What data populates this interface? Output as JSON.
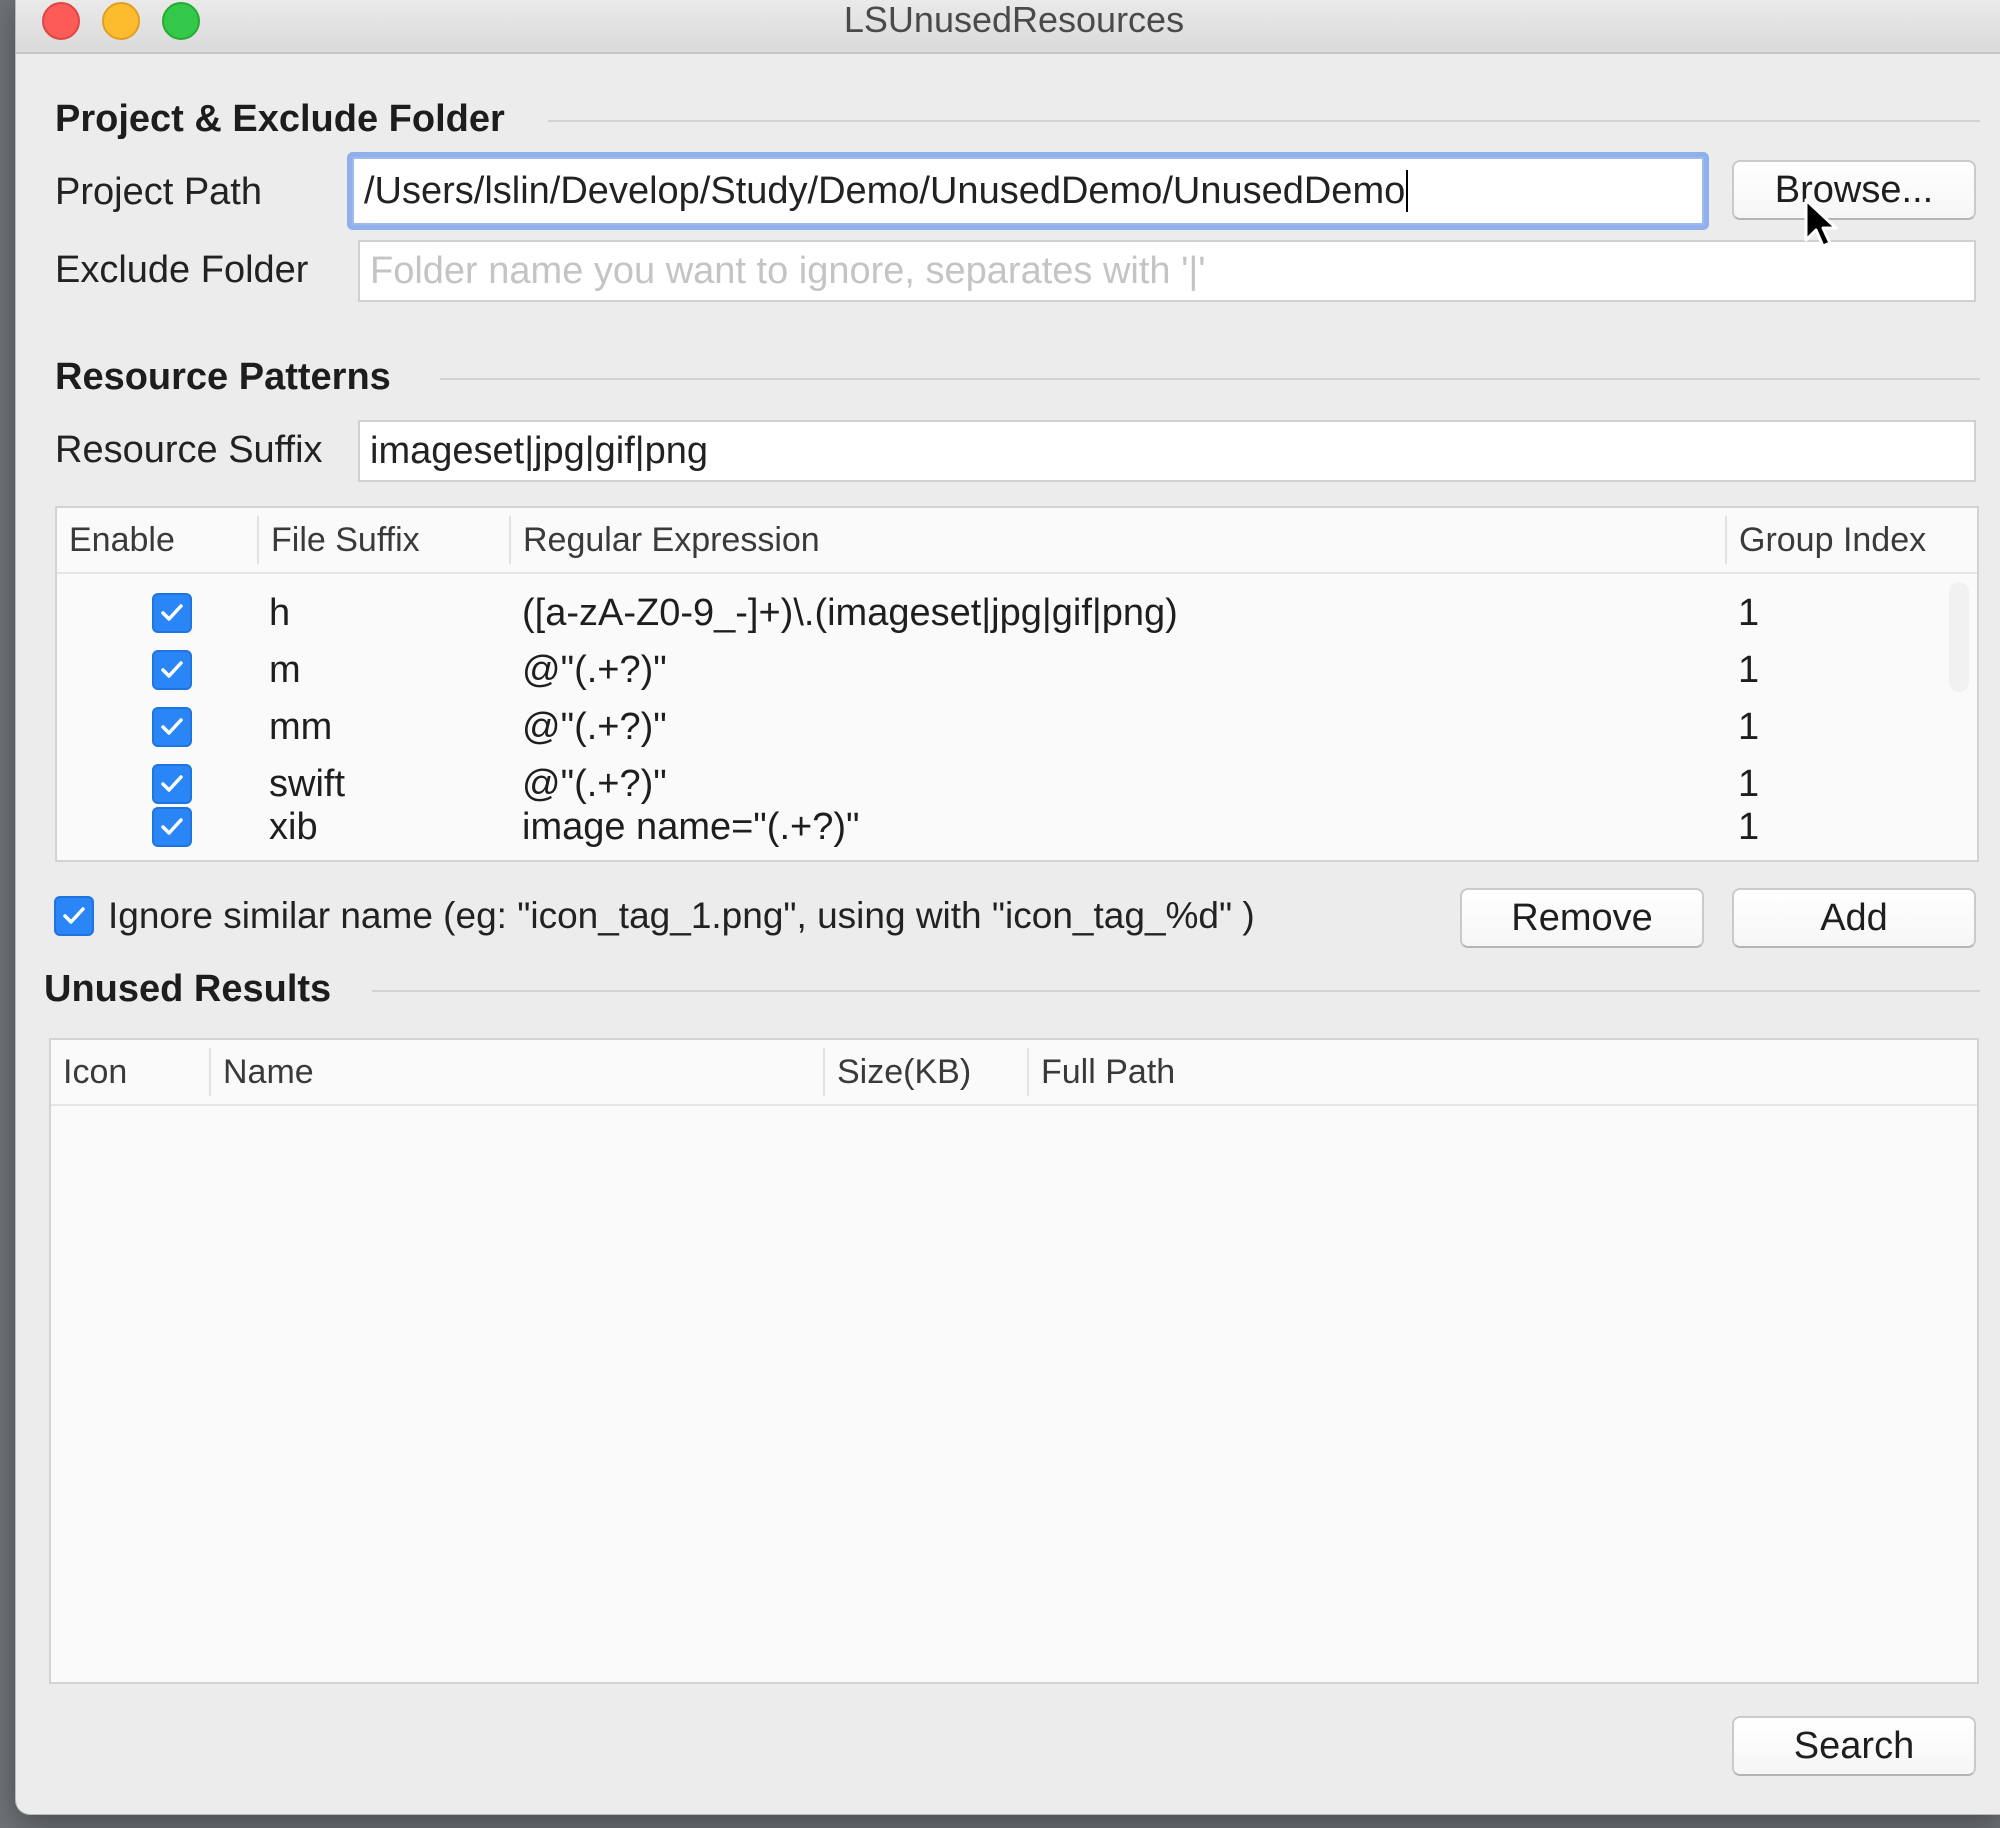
{
  "window": {
    "title": "LSUnusedResources"
  },
  "project_section": {
    "header": "Project & Exclude Folder",
    "project_path_label": "Project Path",
    "project_path_value": "/Users/lslin/Develop/Study/Demo/UnusedDemo/UnusedDemo",
    "browse_button": "Browse...",
    "exclude_folder_label": "Exclude Folder",
    "exclude_folder_placeholder": "Folder name you want to ignore, separates with '|'"
  },
  "patterns_section": {
    "header": "Resource Patterns",
    "resource_suffix_label": "Resource Suffix",
    "resource_suffix_value": "imageset|jpg|gif|png",
    "columns": [
      "Enable",
      "File Suffix",
      "Regular Expression",
      "Group Index"
    ],
    "rows": [
      {
        "enabled": true,
        "suffix": "h",
        "regex": "([a-zA-Z0-9_-]+)\\.(imageset|jpg|gif|png)",
        "group": "1"
      },
      {
        "enabled": true,
        "suffix": "m",
        "regex": "@\"(.+?)\"",
        "group": "1"
      },
      {
        "enabled": true,
        "suffix": "mm",
        "regex": "@\"(.+?)\"",
        "group": "1"
      },
      {
        "enabled": true,
        "suffix": "swift",
        "regex": "@\"(.+?)\"",
        "group": "1"
      },
      {
        "enabled": true,
        "suffix": "xib",
        "regex": "image name=\"(.+?)\"",
        "group": "1"
      }
    ],
    "ignore_similar_checked": true,
    "ignore_similar_label": "Ignore similar name (eg: \"icon_tag_1.png\", using with \"icon_tag_%d\" )",
    "remove_button": "Remove",
    "add_button": "Add"
  },
  "results_section": {
    "header": "Unused Results",
    "columns": [
      "Icon",
      "Name",
      "Size(KB)",
      "Full Path"
    ],
    "search_button": "Search"
  },
  "colors": {
    "accent": "#2a86f7",
    "focus_ring": "#8fb0ea",
    "window_bg": "#ececec"
  }
}
